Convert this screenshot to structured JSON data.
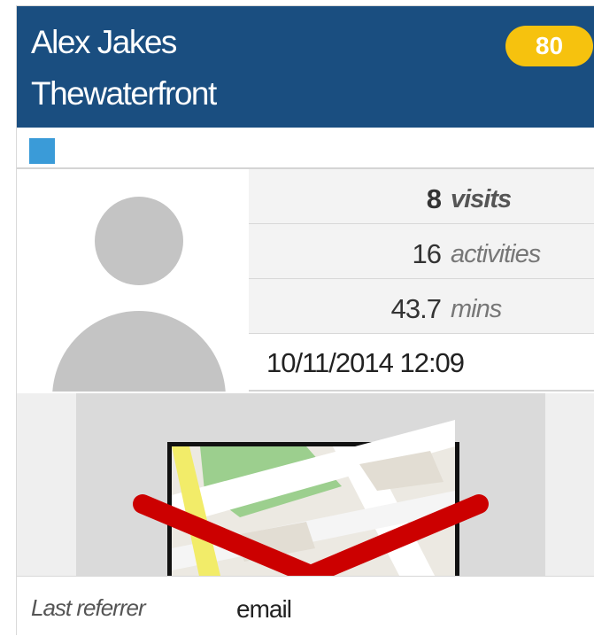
{
  "contact": {
    "name": "Alex Jakes",
    "company": "Thewaterfront",
    "score": "80"
  },
  "tag": {
    "color": "#3a9bd8"
  },
  "avatar": {
    "icon": "person-placeholder-icon"
  },
  "stats": {
    "visits": {
      "value": "8",
      "unit": "visits"
    },
    "activities": {
      "value": "16",
      "unit": "activities"
    },
    "minutes": {
      "value": "43.7",
      "unit": "mins"
    },
    "last_seen": "10/11/2014 12:09"
  },
  "map": {
    "icon": "map-location-icon"
  },
  "referrer": {
    "label": "Last referrer",
    "value": "email"
  },
  "colors": {
    "header": "#1a4e80",
    "score_badge": "#f6c20e",
    "map_marker": "#cc0000"
  }
}
